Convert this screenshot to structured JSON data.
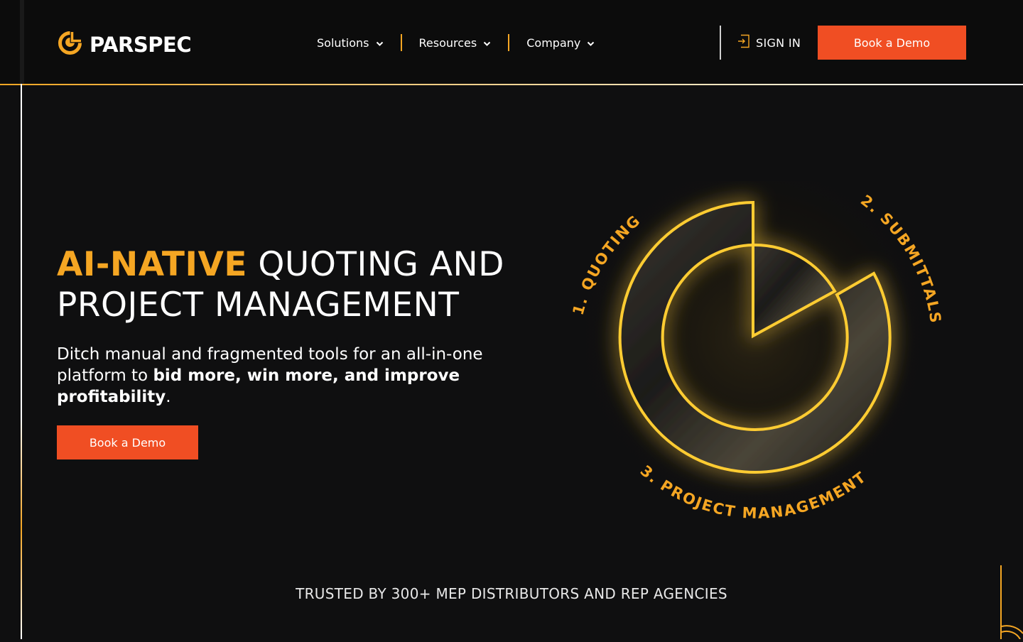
{
  "header": {
    "logo_text": "PARSPEC",
    "nav": [
      {
        "label": "Solutions"
      },
      {
        "label": "Resources"
      },
      {
        "label": "Company"
      }
    ],
    "signin_label": "SIGN IN",
    "cta_label": "Book a Demo"
  },
  "hero": {
    "headline_accent": "AI-NATIVE",
    "headline_rest": "QUOTING AND PROJECT MANAGEMENT",
    "sub_start": "Ditch manual and fragmented tools for an all-in-one platform to",
    "sub_bold": "bid more, win more, and improve profitability",
    "sub_end": ".",
    "cta_label": "Book a Demo",
    "graphic_labels": {
      "quoting": "1. QUOTING",
      "submittals": "2. SUBMITTALS",
      "project_management": "3. PROJECT MANAGEMENT"
    }
  },
  "trusted_text": "TRUSTED BY 300+ MEP DISTRIBUTORS AND REP AGENCIES",
  "colors": {
    "accent": "#f5a623",
    "cta": "#f04e23",
    "background": "#0f0f10"
  },
  "icons": [
    "parspec-logo-icon",
    "chevron-down-icon",
    "sign-in-icon"
  ]
}
